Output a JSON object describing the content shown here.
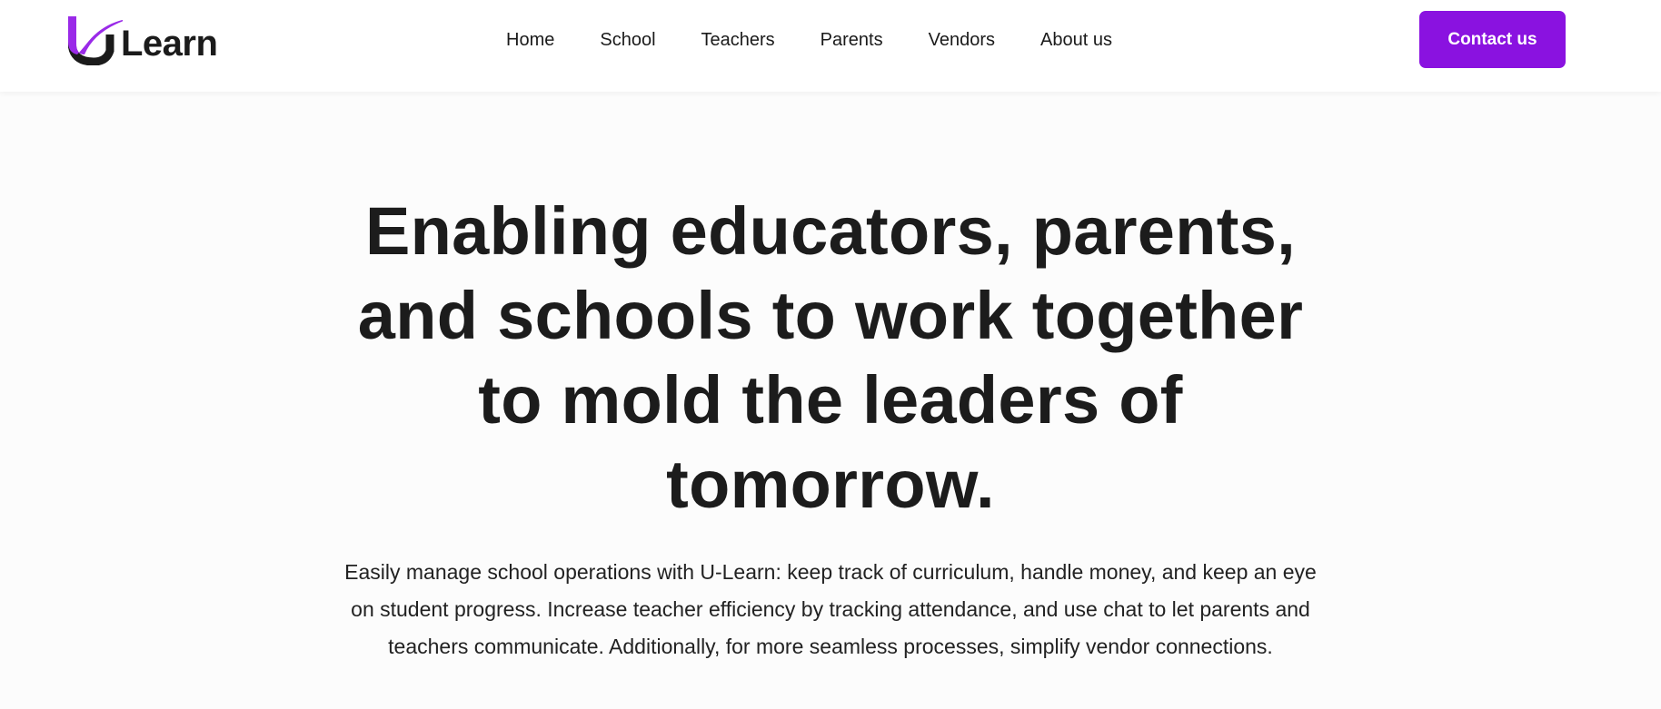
{
  "brand": {
    "logo_text": "Learn",
    "accent_color": "#8a12e0"
  },
  "nav": {
    "items": [
      "Home",
      "School",
      "Teachers",
      "Parents",
      "Vendors",
      "About us"
    ]
  },
  "header": {
    "contact_label": "Contact us"
  },
  "hero": {
    "title": "Enabling educators, parents, and schools to work together to mold the leaders of tomorrow.",
    "subtitle": "Easily manage school operations with U-Learn: keep track of curriculum, handle money, and keep an eye on student progress. Increase teacher efficiency by tracking attendance, and use chat to let parents and teachers communicate. Additionally, for more seamless processes, simplify vendor connections."
  }
}
